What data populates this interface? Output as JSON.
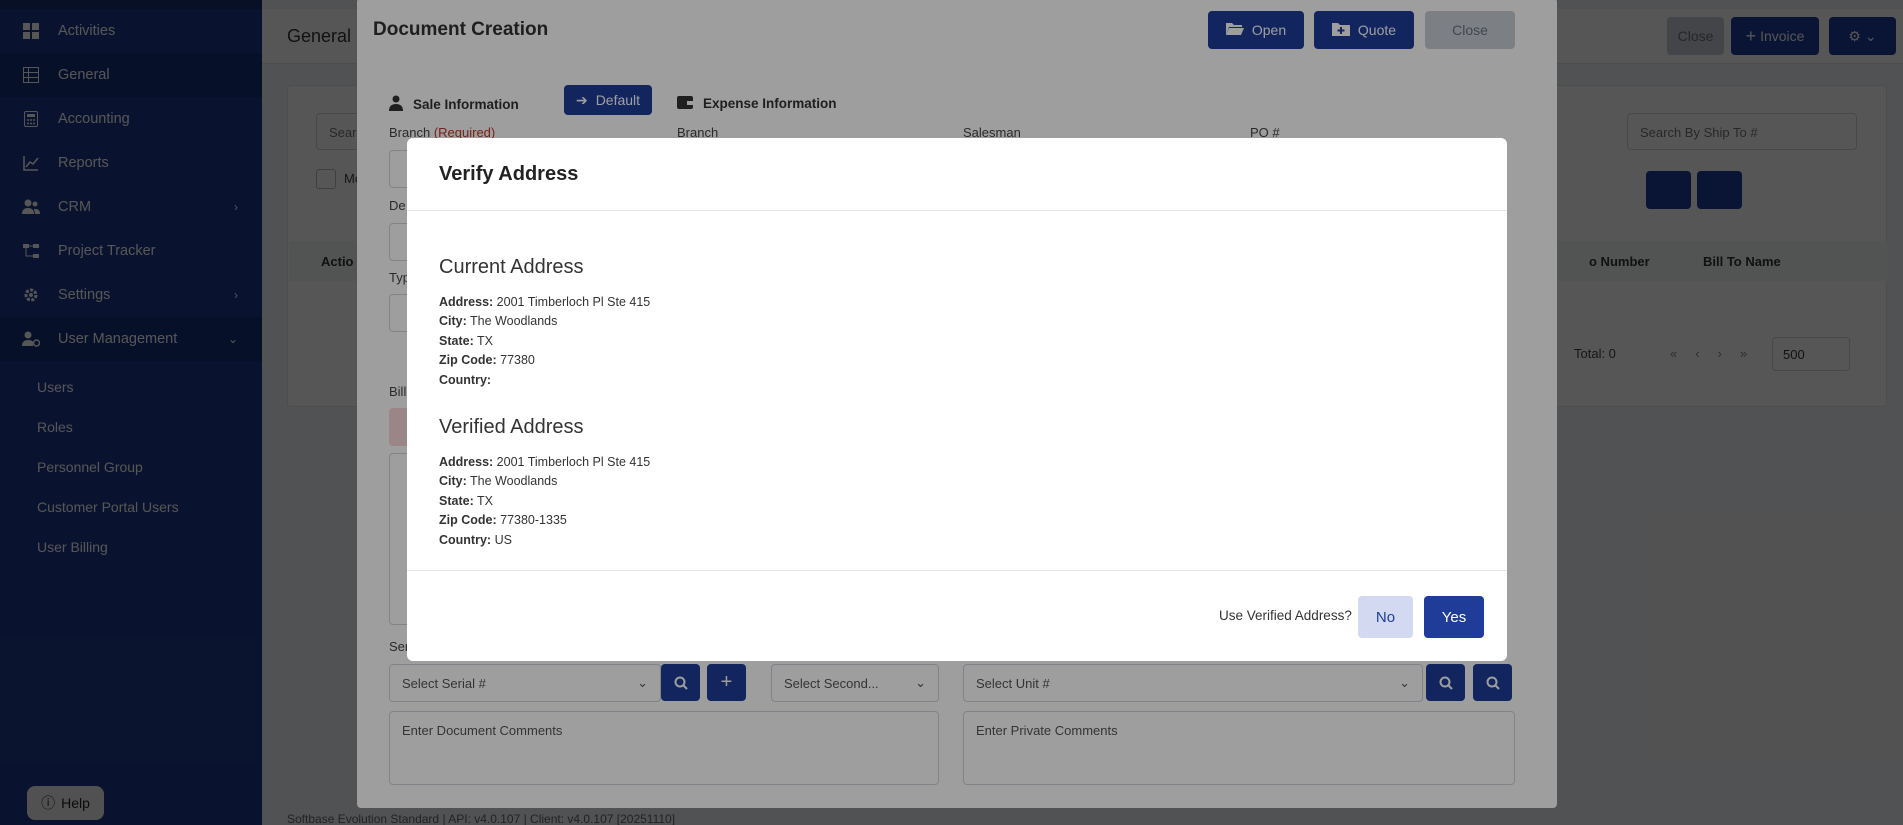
{
  "sidebar": {
    "items": [
      {
        "label": "Activities",
        "icon": "grid-icon"
      },
      {
        "label": "General",
        "icon": "table-icon"
      },
      {
        "label": "Accounting",
        "icon": "calculator-icon"
      },
      {
        "label": "Reports",
        "icon": "chart-line-icon"
      },
      {
        "label": "CRM",
        "icon": "users-icon",
        "has_chevron": true
      },
      {
        "label": "Project Tracker",
        "icon": "sitemap-icon"
      },
      {
        "label": "Settings",
        "icon": "gear-icon",
        "has_chevron": true
      },
      {
        "label": "User Management",
        "icon": "user-gear-icon",
        "expanded": true
      }
    ],
    "sub_items": [
      "Users",
      "Roles",
      "Personnel Group",
      "Customer Portal Users",
      "User Billing"
    ],
    "help_label": "Help"
  },
  "background": {
    "page_title": "General",
    "close_label": "Close",
    "invoice_label": "Invoice",
    "search_shipto_placeholder": "Search By Ship To #",
    "col_to_number": "o Number",
    "col_bill_to_name": "Bill To Name",
    "total_label": "Total: 0",
    "page_size": "500",
    "footer": "Softbase Evolution Standard | API: v4.0.107 | Client: v4.0.107 [20251110]",
    "peek_texts": {
      "search": "Sear",
      "mo": "Mo",
      "actions": "Actio",
      "de": "De",
      "typ": "Typ",
      "bill": "Bill",
      "ser": "Ser"
    }
  },
  "doc_modal": {
    "title": "Document Creation",
    "open_label": "Open",
    "quote_label": "Quote",
    "close_label": "Close",
    "sale_info_label": "Sale Information",
    "default_label": "Default",
    "expense_info_label": "Expense Information",
    "branch_label": "Branch",
    "required_label": "(Required)",
    "branch2_label": "Branch",
    "salesman_label": "Salesman",
    "po_label": "PO #",
    "serial_placeholder": "Select Serial #",
    "second_placeholder": "Select Second...",
    "unit_placeholder": "Select Unit #",
    "doc_comments_placeholder": "Enter Document Comments",
    "private_comments_placeholder": "Enter Private Comments"
  },
  "verify_dialog": {
    "title": "Verify Address",
    "current_heading": "Current Address",
    "verified_heading": "Verified Address",
    "labels": {
      "address": "Address:",
      "city": "City:",
      "state": "State:",
      "zip": "Zip Code:",
      "country": "Country:"
    },
    "current": {
      "address": "2001 Timberloch Pl Ste 415",
      "city": "The Woodlands",
      "state": "TX",
      "zip": "77380",
      "country": ""
    },
    "verified": {
      "address": "2001 Timberloch Pl Ste 415",
      "city": "The Woodlands",
      "state": "TX",
      "zip": "77380-1335",
      "country": "US"
    },
    "question": "Use Verified Address?",
    "no_label": "No",
    "yes_label": "Yes"
  },
  "colors": {
    "sidebar": "#1c3a8a",
    "primary": "#1f3c99",
    "required": "#c0392b"
  }
}
